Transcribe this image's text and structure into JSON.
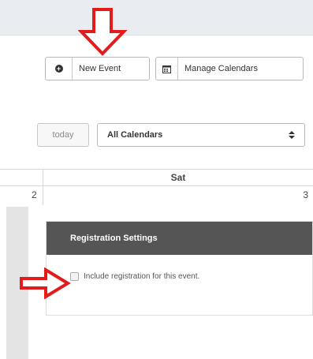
{
  "toolbar": {
    "new_event_label": "New Event",
    "manage_calendars_label": "Manage Calendars"
  },
  "controls": {
    "today_label": "today",
    "calendar_select_value": "All Calendars"
  },
  "calendar": {
    "column_header": "Sat",
    "day_left": "2",
    "day_right": "3"
  },
  "registration": {
    "header": "Registration Settings",
    "checkbox_label": "Include registration for this event."
  },
  "colors": {
    "annotation_arrow": "#e31b1b",
    "panel_header_bg": "#555555",
    "topbar_bg": "#e9ecf0"
  },
  "icons": [
    "plus-circle-icon",
    "calendar-icon",
    "sort-arrows-icon",
    "arrow-down-annotation",
    "arrow-right-annotation"
  ]
}
